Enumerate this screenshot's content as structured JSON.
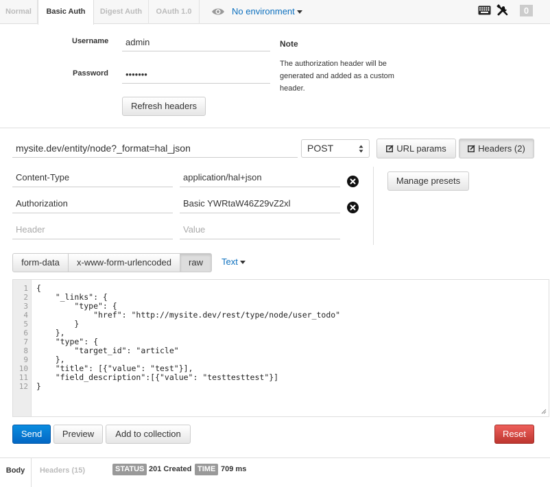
{
  "auth_tabs": [
    {
      "label": "Normal",
      "active": false
    },
    {
      "label": "Basic Auth",
      "active": true
    },
    {
      "label": "Digest Auth",
      "active": false
    },
    {
      "label": "OAuth 1.0",
      "active": false
    }
  ],
  "environment": {
    "label": "No environment",
    "icon": "eye-icon"
  },
  "toolbar": {
    "notification_count": "0",
    "keyboard_icon": "keyboard-icon",
    "tools_icon": "tools-icon"
  },
  "basic_auth": {
    "username_label": "Username",
    "username_value": "admin",
    "password_label": "Password",
    "password_value": "admin12",
    "note_title": "Note",
    "note_text": "The authorization header will be generated and added as a custom header.",
    "refresh_button": "Refresh headers"
  },
  "request": {
    "url": "mysite.dev/entity/node?_format=hal_json",
    "method": "POST",
    "url_params_button": "URL params",
    "headers_button": "Headers (2)"
  },
  "headers": {
    "rows": [
      {
        "key": "Content-Type",
        "value": "application/hal+json"
      },
      {
        "key": "Authorization",
        "value": "Basic YWRtaW46Z29vZ2xl"
      }
    ],
    "key_placeholder": "Header",
    "value_placeholder": "Value",
    "manage_presets_button": "Manage presets"
  },
  "body_tabs": [
    {
      "label": "form-data",
      "active": false
    },
    {
      "label": "x-www-form-urlencoded",
      "active": false
    },
    {
      "label": "raw",
      "active": true
    }
  ],
  "body_format": "Text",
  "editor": {
    "line_numbers": [
      "1",
      "2",
      "3",
      "4",
      "5",
      "6",
      "7",
      "8",
      "9",
      "10",
      "11",
      "12"
    ],
    "lines": [
      "{",
      "    \"_links\": {",
      "        \"type\": {",
      "            \"href\": \"http://mysite.dev/rest/type/node/user_todo\"",
      "        }",
      "    },",
      "    \"type\": {",
      "        \"target_id\": \"article\"",
      "    },",
      "    \"title\": [{\"value\": \"test\"}],",
      "    \"field_description\":[{\"value\": \"testtesttest\"}]",
      "}"
    ]
  },
  "actions": {
    "send": "Send",
    "preview": "Preview",
    "add_to_collection": "Add to collection",
    "reset": "Reset"
  },
  "response": {
    "tabs": [
      {
        "label": "Body",
        "active": true
      },
      {
        "label": "Headers (15)",
        "active": false
      }
    ],
    "status_label": "STATUS",
    "status_value": "201 Created",
    "time_label": "TIME",
    "time_value": "709 ms"
  },
  "colors": {
    "primary": "#0367c4",
    "danger": "#bd362f",
    "link": "#0b6fbe"
  }
}
